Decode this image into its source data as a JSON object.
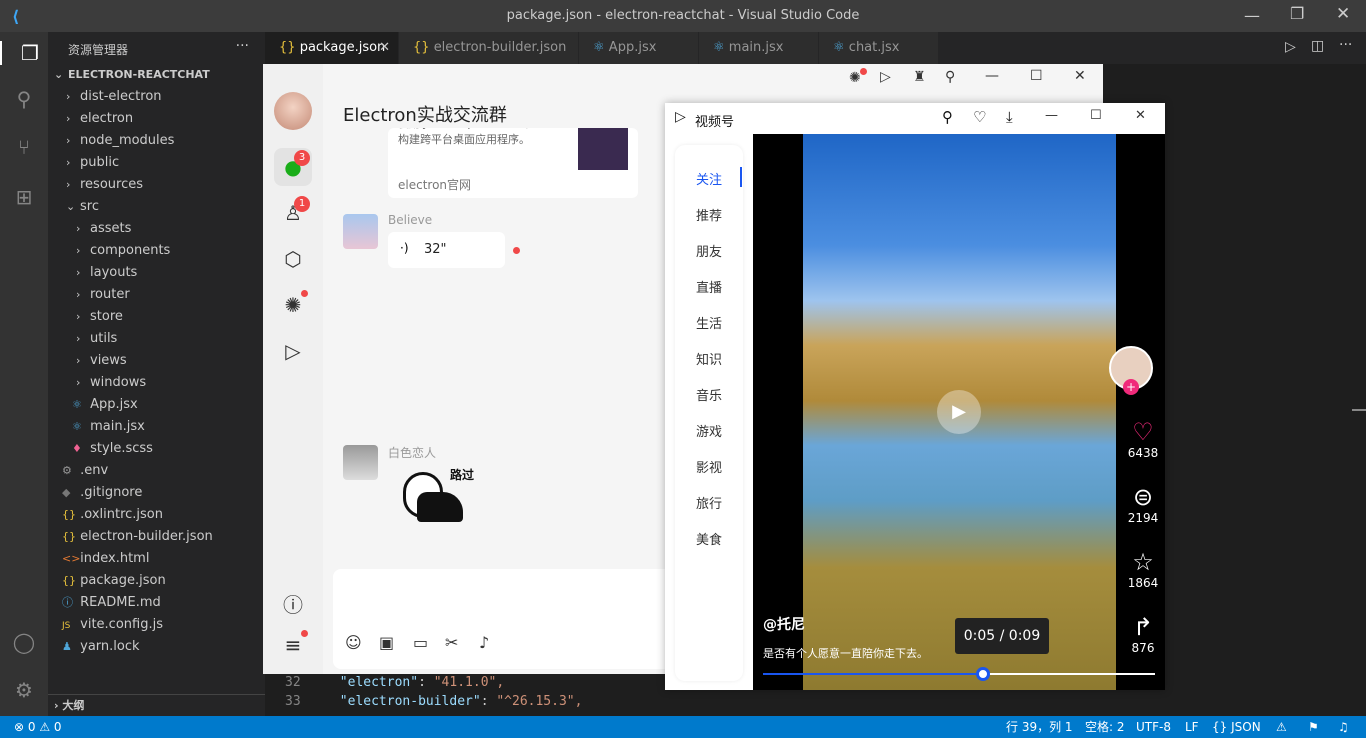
{
  "window_title": "package.json - electron-reactchat - Visual Studio Code",
  "explorer": {
    "header": "资源管理器",
    "more": "···",
    "root": "ELECTRON-REACTCHAT",
    "outline": "大纲",
    "items": [
      {
        "label": "dist-electron",
        "kind": "folder"
      },
      {
        "label": "electron",
        "kind": "folder"
      },
      {
        "label": "node_modules",
        "kind": "folder"
      },
      {
        "label": "public",
        "kind": "folder"
      },
      {
        "label": "resources",
        "kind": "folder"
      },
      {
        "label": "src",
        "kind": "folder-open"
      },
      {
        "label": "assets",
        "kind": "folder"
      },
      {
        "label": "components",
        "kind": "folder"
      },
      {
        "label": "layouts",
        "kind": "folder"
      },
      {
        "label": "router",
        "kind": "folder"
      },
      {
        "label": "store",
        "kind": "folder"
      },
      {
        "label": "utils",
        "kind": "folder"
      },
      {
        "label": "views",
        "kind": "folder"
      },
      {
        "label": "windows",
        "kind": "folder"
      },
      {
        "label": "App.jsx",
        "kind": "file"
      },
      {
        "label": "main.jsx",
        "kind": "file"
      },
      {
        "label": "style.scss",
        "kind": "file"
      },
      {
        "label": ".env",
        "kind": "file"
      },
      {
        "label": ".gitignore",
        "kind": "file"
      },
      {
        "label": ".oxlintrc.json",
        "kind": "file"
      },
      {
        "label": "electron-builder.json",
        "kind": "file"
      },
      {
        "label": "index.html",
        "kind": "file"
      },
      {
        "label": "package.json",
        "kind": "file"
      },
      {
        "label": "README.md",
        "kind": "file"
      },
      {
        "label": "vite.config.js",
        "kind": "file"
      },
      {
        "label": "yarn.lock",
        "kind": "file"
      }
    ]
  },
  "tabs": [
    {
      "label": "package.json",
      "icon": "{}"
    },
    {
      "label": "electron-builder.json",
      "icon": "{}"
    },
    {
      "label": "App.jsx",
      "icon": "⚛"
    },
    {
      "label": "main.jsx",
      "icon": "⚛"
    },
    {
      "label": "chat.jsx",
      "icon": "⚛"
    }
  ],
  "code": [
    {
      "num": "32",
      "key": "\"electron\"",
      "val": "\"41.1.0\","
    },
    {
      "num": "33",
      "key": "\"electron-builder\"",
      "val": "\"^26.15.3\","
    }
  ],
  "status": {
    "errors": "0",
    "warnings": "0",
    "position": "行 39，列 1",
    "spaces": "空格: 2",
    "encoding": "UTF-8",
    "eol": "LF",
    "lang": "JSON"
  },
  "chat": {
    "title": "Electron实战交流群",
    "badge_chat": "3",
    "badge_contacts": "1",
    "card": {
      "text1": "使用 JavaScript、HTML 和 CSS 构建跨平台桌面应用程序。",
      "source": "electron官网"
    },
    "msg1": {
      "name": "Believe",
      "voice": "32\""
    },
    "msg2": {
      "name": "白色恋人",
      "sticker_text": "路过"
    }
  },
  "video": {
    "title": "视频号",
    "categories": [
      "关注",
      "推荐",
      "朋友",
      "直播",
      "生活",
      "知识",
      "音乐",
      "游戏",
      "影视",
      "旅行",
      "美食"
    ],
    "likes": "6438",
    "comments": "2194",
    "stars": "1864",
    "shares": "876",
    "author": "@托尼",
    "desc": "是否有个人愿意一直陪你走下去。",
    "time": "0:05 / 0:09",
    "progress": 0.56
  }
}
